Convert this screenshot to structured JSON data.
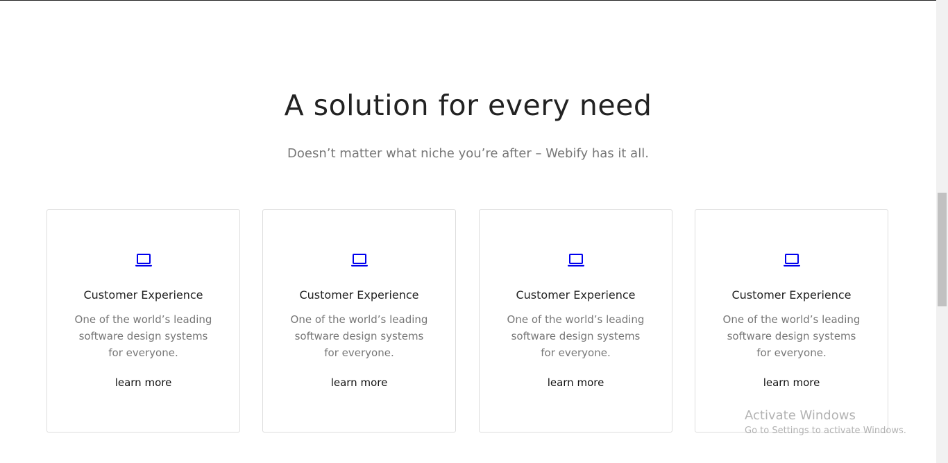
{
  "section": {
    "heading": "A solution for every need",
    "subheading": "Doesn’t matter what niche you’re after – Webify has it all."
  },
  "cards": [
    {
      "icon": "laptop-icon",
      "title": "Customer Experience",
      "description": "One of the world’s leading software design systems for everyone.",
      "link": "learn more"
    },
    {
      "icon": "laptop-icon",
      "title": "Customer Experience",
      "description": "One of the world’s leading software design systems for everyone.",
      "link": "learn more"
    },
    {
      "icon": "laptop-icon",
      "title": "Customer Experience",
      "description": "One of the world’s leading software design systems for everyone.",
      "link": "learn more"
    },
    {
      "icon": "laptop-icon",
      "title": "Customer Experience",
      "description": "One of the world’s leading software design systems for everyone.",
      "link": "learn more"
    }
  ],
  "watermark": {
    "title": "Activate Windows",
    "subtitle": "Go to Settings to activate Windows."
  },
  "colors": {
    "icon": "#0000ee",
    "heading": "#222222",
    "muted": "#777777"
  }
}
